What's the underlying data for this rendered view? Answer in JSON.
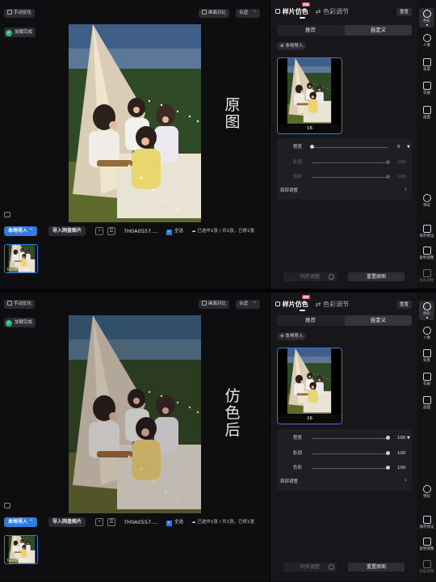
{
  "panels": [
    {
      "id": "top",
      "left": {
        "manual_optimize": "手动优化",
        "compare": "画面对比",
        "fit": "合适",
        "loaded": "加载完成",
        "side_label": "原图",
        "import_local": "本地导入",
        "import_cloud": "导入网盘图片",
        "filename": "7H0A0557....",
        "select_all": "全选",
        "status": "已选中1张 / 共1张，已修1张",
        "thumb_caption": "7H0A0557.JPG"
      },
      "right": {
        "tab_style": "样片仿色",
        "badge_new": "焕新",
        "tab_color": "色彩调节",
        "reset": "重置",
        "seg_recommend": "推荐",
        "seg_custom": "自定义",
        "local_import": "本地导入",
        "sample_caption": "16",
        "sliders": [
          {
            "label": "程度",
            "value": "0",
            "active": true,
            "level": 0.0
          },
          {
            "label": "影调",
            "value": "100",
            "active": false,
            "level": 1.0
          },
          {
            "label": "色彩",
            "value": "100",
            "active": false,
            "level": 1.0
          }
        ],
        "local_adjust": "局部调整",
        "sync_adjust": "同步调整",
        "regen": "重置原图"
      }
    },
    {
      "id": "bottom",
      "left": {
        "manual_optimize": "手动优化",
        "compare": "画面对比",
        "fit": "合适",
        "loaded": "加载完成",
        "side_label": "仿色后",
        "import_local": "本地导入",
        "import_cloud": "导入网盘图片",
        "filename": "7H0A0557....",
        "select_all": "全选",
        "status": "已选中1张 / 共1张，已修1张",
        "thumb_caption": "7H0A0557.JPG"
      },
      "right": {
        "tab_style": "样片仿色",
        "badge_new": "焕新",
        "tab_color": "色彩调节",
        "reset": "重置",
        "seg_recommend": "推荐",
        "seg_custom": "自定义",
        "local_import": "本地导入",
        "sample_caption": "16",
        "sliders": [
          {
            "label": "程度",
            "value": "100",
            "active": true,
            "level": 1.0
          },
          {
            "label": "影调",
            "value": "100",
            "active": true,
            "level": 1.0
          },
          {
            "label": "色彩",
            "value": "100",
            "active": true,
            "level": 1.0
          }
        ],
        "local_adjust": "局部调整",
        "sync_adjust": "同步调整",
        "regen": "重置原图"
      }
    }
  ],
  "toolbar": [
    {
      "label": "色彩",
      "icon": "palette-icon",
      "active": true
    },
    {
      "label": "人像",
      "icon": "portrait-icon",
      "active": false
    },
    {
      "label": "背景",
      "icon": "background-icon",
      "active": false
    },
    {
      "label": "衣服",
      "icon": "clothes-icon",
      "active": false
    },
    {
      "label": "画面",
      "icon": "crop-icon",
      "active": false
    },
    {
      "label": "预设",
      "icon": "preset-icon",
      "active": false
    },
    {
      "label": "保存预设",
      "icon": "save-preset-icon",
      "active": false
    },
    {
      "label": "复制调整",
      "icon": "copy-adjust-icon",
      "active": false
    },
    {
      "label": "粘贴调整",
      "icon": "paste-adjust-icon",
      "active": false
    }
  ],
  "colors": {
    "accent": "#2f7be0",
    "success": "#2bb673",
    "badge": "#d12b4a"
  }
}
